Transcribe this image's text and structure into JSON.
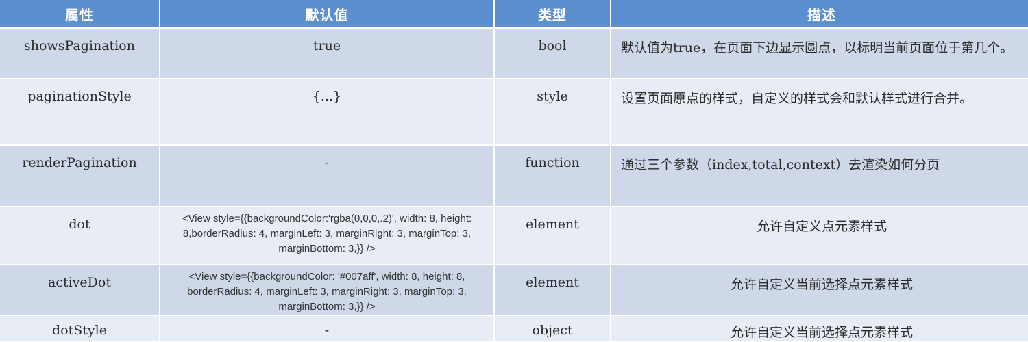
{
  "headers": [
    "属性",
    "默认值",
    "类型",
    "描述"
  ],
  "rows": [
    {
      "name": "showsPagination",
      "default": "true",
      "type": "bool",
      "desc": "默认值为true，在页面下边显示圆点，以标明当前页面位于第几个。"
    },
    {
      "name": "paginationStyle",
      "default": "{...}",
      "type": "style",
      "desc": "设置页面原点的样式，自定义的样式会和默认样式进行合并。"
    },
    {
      "name": "renderPagination",
      "default": "-",
      "type": "function",
      "desc": "通过三个参数（index,total,context）去渲染如何分页"
    },
    {
      "name": "dot",
      "default": "<View style={{backgroundColor:'rgba(0,0,0,.2)', width: 8, height: 8,borderRadius: 4, marginLeft: 3, marginRight: 3, marginTop: 3, marginBottom: 3,}} />",
      "type": "element",
      "desc": "允许自定义点元素样式"
    },
    {
      "name": "activeDot",
      "default": "<View style={{backgroundColor: '#007aff', width: 8, height: 8, borderRadius: 4, marginLeft: 3, marginRight: 3, marginTop: 3, marginBottom: 3,}} />",
      "type": "element",
      "desc": "允许自定义当前选择点元素样式"
    },
    {
      "name": "dotStyle",
      "default": "-",
      "type": "object",
      "desc": "允许自定义当前选择点元素样式"
    }
  ],
  "colors": {
    "header": "#5b8fd0",
    "row_dark": "#cfd8e8",
    "row_light": "#e8edf5"
  }
}
